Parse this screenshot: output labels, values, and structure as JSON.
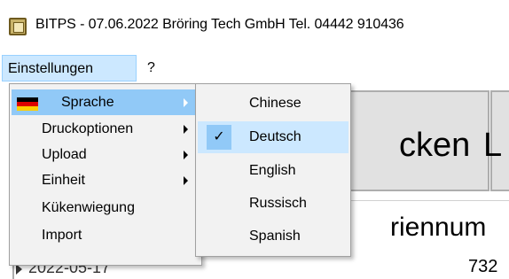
{
  "window": {
    "title": "BITPS - 07.06.2022 Bröring Tech GmbH  Tel. 04442 910436",
    "icon": "app-icon"
  },
  "menubar": {
    "items": [
      {
        "label": "Einstellungen"
      },
      {
        "label": "?"
      }
    ]
  },
  "dropdown": {
    "items": [
      {
        "label": "Sprache",
        "icon": "germany-flag-icon",
        "submenu": true
      },
      {
        "label": "Druckoptionen",
        "submenu": true
      },
      {
        "label": "Upload",
        "submenu": true
      },
      {
        "label": "Einheit",
        "submenu": true
      },
      {
        "label": "Kükenwiegung",
        "submenu": false
      },
      {
        "label": "Import",
        "submenu": false
      }
    ]
  },
  "language_submenu": {
    "selected": "Deutsch",
    "items": [
      {
        "label": "Chinese"
      },
      {
        "label": "Deutsch"
      },
      {
        "label": "English"
      },
      {
        "label": "Russisch"
      },
      {
        "label": "Spanish"
      }
    ]
  },
  "background": {
    "button1_label": "cken",
    "button2_label": "L",
    "column_header": "riennum",
    "row_date": "2022-05-17",
    "row_number": "732"
  },
  "colors": {
    "highlight": "#91c9f7",
    "menu_active": "#cce8ff",
    "menu_bg": "#f2f2f2"
  }
}
